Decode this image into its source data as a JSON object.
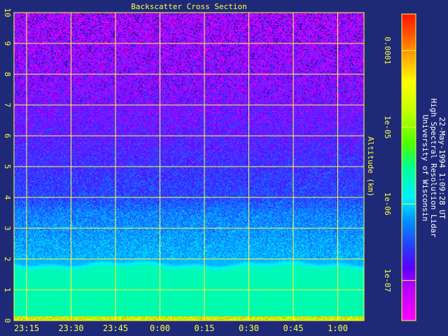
{
  "chart_data": {
    "type": "heatmap",
    "title": "Backscatter Cross Section",
    "ylabel": "Altitude (km)",
    "xlabel": "",
    "x_ticks": [
      "23:15",
      "23:30",
      "23:45",
      "0:00",
      "0:15",
      "0:30",
      "0:45",
      "1:00"
    ],
    "y_ticks": [
      "0",
      "1",
      "2",
      "3",
      "4",
      "5",
      "6",
      "7",
      "8",
      "9",
      "10"
    ],
    "ylim": [
      0,
      10
    ],
    "grid": true,
    "colorbar": {
      "scale": "log",
      "range": [
        3e-08,
        0.0003
      ],
      "ticks": [
        {
          "value": 0.0001,
          "label": "0.0001"
        },
        {
          "value": 1e-05,
          "label": "1e-05"
        },
        {
          "value": 1e-06,
          "label": "1e-06"
        },
        {
          "value": 1e-07,
          "label": "1e-07"
        }
      ]
    },
    "altitude_profile_km": [
      0,
      0.2,
      1.0,
      1.7,
      1.9,
      2.5,
      2.9,
      3.5,
      4.0,
      5.0,
      6.0,
      7.0,
      8.5,
      10.0
    ],
    "backscatter_profile": [
      2.5e-06,
      2.5e-06,
      2.4e-06,
      2.2e-06,
      8e-07,
      7e-07,
      6e-07,
      5e-07,
      3e-07,
      2.3e-07,
      1.7e-07,
      1.3e-07,
      1e-07,
      8e-08
    ]
  },
  "caption": {
    "lines": [
      "University of Wisconsin",
      "High Spectral Resolution Lidar",
      "22-May-1994  1:09:28 UT"
    ]
  },
  "colors": {
    "background": "#1e2a78",
    "grid": "#ffff40",
    "text": "#ffff40",
    "caption": "#ffffff"
  }
}
